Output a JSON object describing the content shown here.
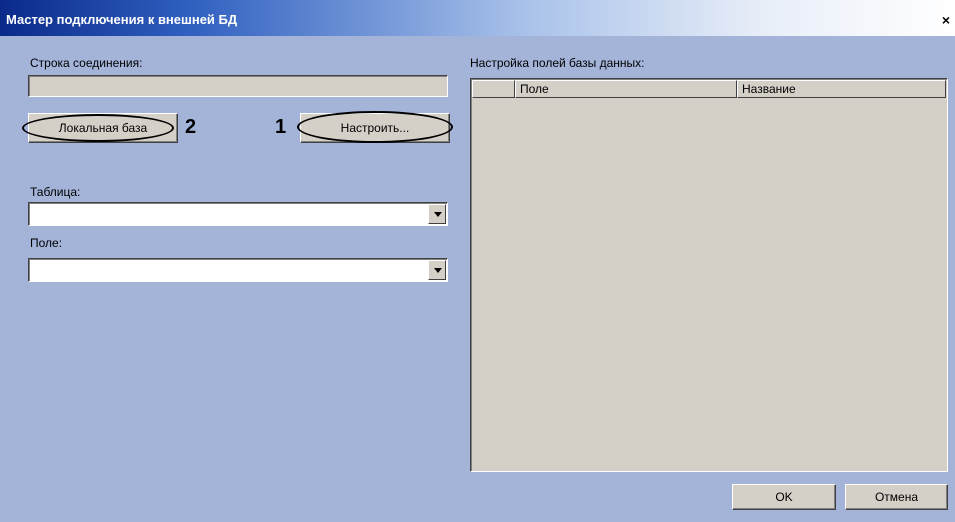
{
  "window": {
    "title": "Мастер подключения к внешней БД",
    "close_glyph": "✕"
  },
  "connection": {
    "label": "Строка соединения:",
    "value": "",
    "local_db_button": "Локальная база",
    "configure_button": "Настроить...",
    "marker_local": "2",
    "marker_configure": "1"
  },
  "table": {
    "label": "Таблица:",
    "value": ""
  },
  "field": {
    "label": "Поле:",
    "value": ""
  },
  "db_fields": {
    "label": "Настройка полей базы данных:",
    "columns": [
      "Поле",
      "Название"
    ]
  },
  "footer": {
    "ok_button": "OK",
    "cancel_button": "Отмена"
  }
}
